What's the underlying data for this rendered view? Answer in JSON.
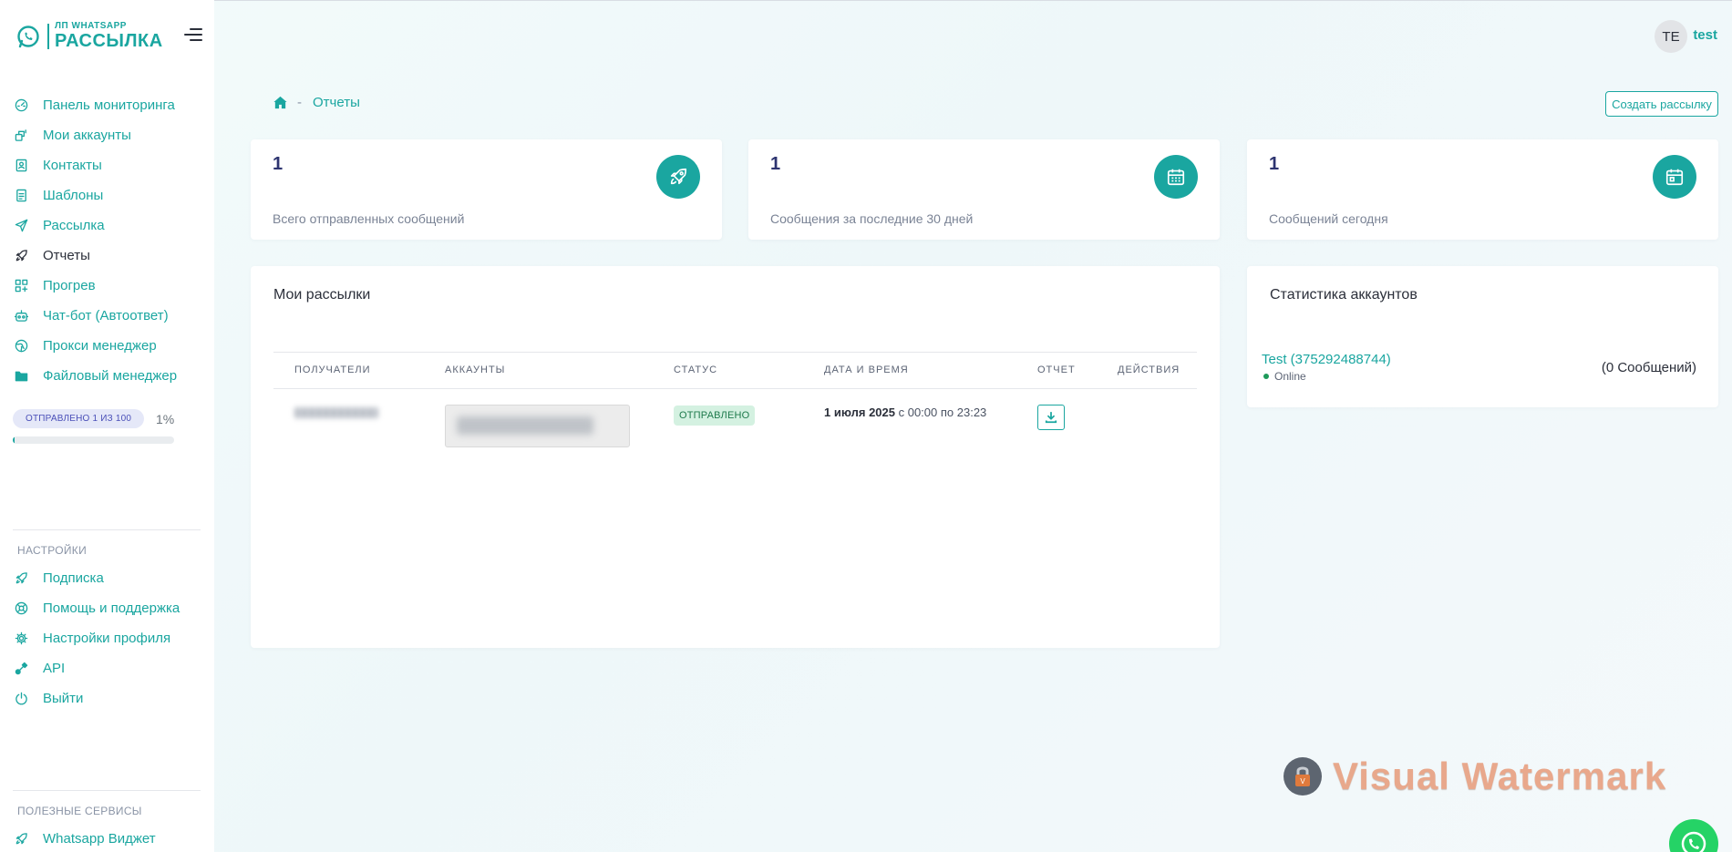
{
  "brand": {
    "top": "WHATSAPP",
    "bottom": "РАССЫЛКА",
    "badge": "ЛП"
  },
  "nav": [
    {
      "label": "Панель мониторинга",
      "icon": "dashboard-icon"
    },
    {
      "label": "Мои аккаунты",
      "icon": "accounts-icon"
    },
    {
      "label": "Контакты",
      "icon": "contacts-icon"
    },
    {
      "label": "Шаблоны",
      "icon": "templates-icon"
    },
    {
      "label": "Рассылка",
      "icon": "send-icon"
    },
    {
      "label": "Отчеты",
      "icon": "rocket-icon",
      "active": true
    },
    {
      "label": "Прогрев",
      "icon": "warmup-icon"
    },
    {
      "label": "Чат-бот (Автоответ)",
      "icon": "robot-icon"
    },
    {
      "label": "Прокси менеджер",
      "icon": "globe-icon"
    },
    {
      "label": "Файловый менеджер",
      "icon": "folder-icon"
    }
  ],
  "quota": {
    "badge": "ОТПРАВЛЕНО 1 ИЗ 100",
    "percent_label": "1%",
    "percent": 1
  },
  "settings": {
    "title": "НАСТРОЙКИ",
    "items": [
      {
        "label": "Подписка",
        "icon": "rocket-icon"
      },
      {
        "label": "Помощь и поддержка",
        "icon": "support-icon"
      },
      {
        "label": "Настройки профиля",
        "icon": "gear-icon"
      },
      {
        "label": "API",
        "icon": "api-icon"
      },
      {
        "label": "Выйти",
        "icon": "power-icon"
      }
    ]
  },
  "services": {
    "title": "ПОЛЕЗНЫЕ СЕРВИСЫ",
    "items": [
      {
        "label": "Whatsapp Виджет",
        "icon": "rocket-icon"
      }
    ]
  },
  "user": {
    "initials": "TE",
    "name": "test"
  },
  "breadcrumb": {
    "current": "Отчеты"
  },
  "create_button": "Создать рассылку",
  "stats": [
    {
      "value": "1",
      "label": "Всего отправленных сообщений",
      "icon": "rocket-icon"
    },
    {
      "value": "1",
      "label": "Сообщения за последние 30 дней",
      "icon": "calendar-icon"
    },
    {
      "value": "1",
      "label": "Сообщений сегодня",
      "icon": "calendar-icon"
    }
  ],
  "mailings": {
    "title": "Мои рассылки",
    "columns": [
      "ПОЛУЧАТЕЛИ",
      "АККАУНТЫ",
      "СТАТУС",
      "ДАТА И ВРЕМЯ",
      "ОТЧЕТ",
      "ДЕЙСТВИЯ"
    ],
    "row": {
      "status": "ОТПРАВЛЕНО",
      "date_bold": "1 июля 2025",
      "date_rest": " с 00:00 по 23:23"
    }
  },
  "accounts_stats": {
    "title": "Статистика аккаунтов",
    "account": "Test (375292488744)",
    "status": "Online",
    "count": "(0 Сообщений)"
  },
  "watermark": "Visual Watermark",
  "colors": {
    "accent": "#1aa6a0",
    "online": "#1e9a5a",
    "whatsapp": "#25d366"
  }
}
